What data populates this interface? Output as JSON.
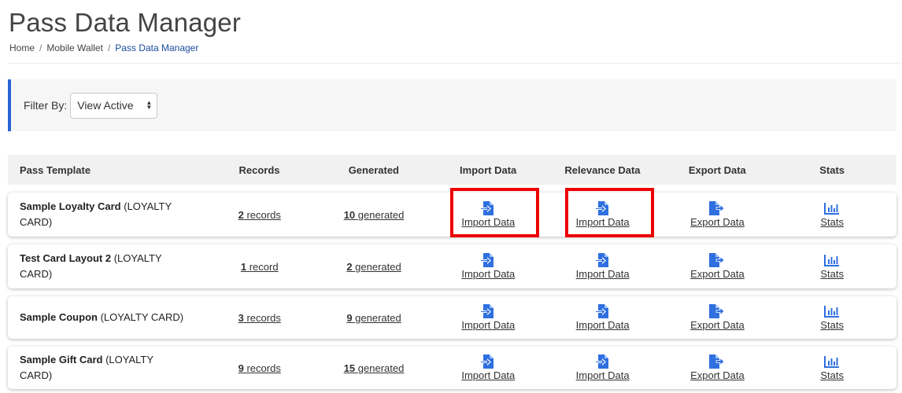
{
  "header": {
    "title": "Pass Data Manager",
    "breadcrumb": [
      "Home",
      "Mobile Wallet",
      "Pass Data Manager"
    ],
    "separator": "/"
  },
  "filter": {
    "label": "Filter By:",
    "selected": "View Active"
  },
  "table": {
    "columns": [
      "Pass Template",
      "Records",
      "Generated",
      "Import Data",
      "Relevance Data",
      "Export Data",
      "Stats"
    ],
    "rows": [
      {
        "name": "Sample Loyalty Card",
        "type": "(LOYALTY CARD)",
        "records_count": "2",
        "records_word": "records",
        "generated_count": "10",
        "generated_word": "generated",
        "import_label": "Import Data",
        "relevance_label": "Import Data",
        "export_label": "Export Data",
        "stats_label": "Stats"
      },
      {
        "name": "Test Card Layout 2",
        "type": "(LOYALTY CARD)",
        "records_count": "1",
        "records_word": "record",
        "generated_count": "2",
        "generated_word": "generated",
        "import_label": "Import Data",
        "relevance_label": "Import Data",
        "export_label": "Export Data",
        "stats_label": "Stats"
      },
      {
        "name": "Sample Coupon",
        "type": "(LOYALTY CARD)",
        "records_count": "3",
        "records_word": "records",
        "generated_count": "9",
        "generated_word": "generated",
        "import_label": "Import Data",
        "relevance_label": "Import Data",
        "export_label": "Export Data",
        "stats_label": "Stats"
      },
      {
        "name": "Sample Gift Card",
        "type": "(LOYALTY CARD)",
        "records_count": "9",
        "records_word": "records",
        "generated_count": "15",
        "generated_word": "generated",
        "import_label": "Import Data",
        "relevance_label": "Import Data",
        "export_label": "Export Data",
        "stats_label": "Stats"
      }
    ]
  },
  "icons": {
    "import": "file-import-icon",
    "export": "file-export-icon",
    "stats": "bar-chart-icon"
  },
  "colors": {
    "accent": "#2b63d6",
    "icon_blue": "#2f6fe0",
    "highlight": "#ee0000",
    "breadcrumb_active": "#1a4a9c"
  }
}
